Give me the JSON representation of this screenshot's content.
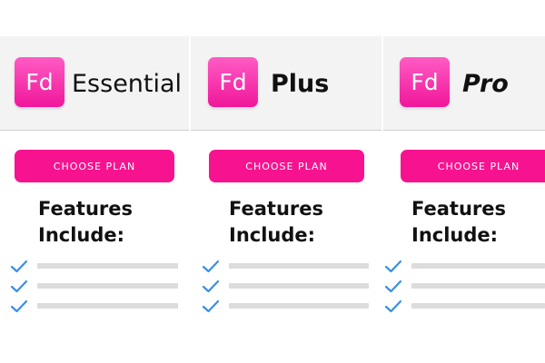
{
  "plans": [
    {
      "logo_text": "Fd",
      "name": "Essential",
      "button_label": "CHOOSE PLAN",
      "features_heading_line1": "Features",
      "features_heading_line2": "Include:"
    },
    {
      "logo_text": "Fd",
      "name": "Plus",
      "button_label": "CHOOSE PLAN",
      "features_heading_line1": "Features",
      "features_heading_line2": "Include:"
    },
    {
      "logo_text": "Fd",
      "name": "Pro",
      "button_label": "CHOOSE PLAN",
      "features_heading_line1": "Features",
      "features_heading_line2": "Include:"
    }
  ],
  "colors": {
    "brand_pink": "#f7138f",
    "check_blue": "#3a8ee6",
    "placeholder_bar": "#dcdcdc",
    "header_bg": "#f3f3f3"
  },
  "icons": [
    "checkmark-icon"
  ]
}
